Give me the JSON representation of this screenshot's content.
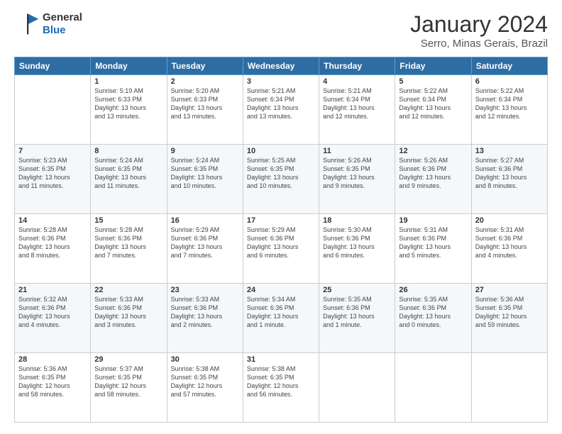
{
  "logo": {
    "line1": "General",
    "line2": "Blue"
  },
  "title": "January 2024",
  "location": "Serro, Minas Gerais, Brazil",
  "days_header": [
    "Sunday",
    "Monday",
    "Tuesday",
    "Wednesday",
    "Thursday",
    "Friday",
    "Saturday"
  ],
  "weeks": [
    [
      {
        "num": "",
        "detail": ""
      },
      {
        "num": "1",
        "detail": "Sunrise: 5:19 AM\nSunset: 6:33 PM\nDaylight: 13 hours\nand 13 minutes."
      },
      {
        "num": "2",
        "detail": "Sunrise: 5:20 AM\nSunset: 6:33 PM\nDaylight: 13 hours\nand 13 minutes."
      },
      {
        "num": "3",
        "detail": "Sunrise: 5:21 AM\nSunset: 6:34 PM\nDaylight: 13 hours\nand 13 minutes."
      },
      {
        "num": "4",
        "detail": "Sunrise: 5:21 AM\nSunset: 6:34 PM\nDaylight: 13 hours\nand 12 minutes."
      },
      {
        "num": "5",
        "detail": "Sunrise: 5:22 AM\nSunset: 6:34 PM\nDaylight: 13 hours\nand 12 minutes."
      },
      {
        "num": "6",
        "detail": "Sunrise: 5:22 AM\nSunset: 6:34 PM\nDaylight: 13 hours\nand 12 minutes."
      }
    ],
    [
      {
        "num": "7",
        "detail": "Sunrise: 5:23 AM\nSunset: 6:35 PM\nDaylight: 13 hours\nand 11 minutes."
      },
      {
        "num": "8",
        "detail": "Sunrise: 5:24 AM\nSunset: 6:35 PM\nDaylight: 13 hours\nand 11 minutes."
      },
      {
        "num": "9",
        "detail": "Sunrise: 5:24 AM\nSunset: 6:35 PM\nDaylight: 13 hours\nand 10 minutes."
      },
      {
        "num": "10",
        "detail": "Sunrise: 5:25 AM\nSunset: 6:35 PM\nDaylight: 13 hours\nand 10 minutes."
      },
      {
        "num": "11",
        "detail": "Sunrise: 5:26 AM\nSunset: 6:35 PM\nDaylight: 13 hours\nand 9 minutes."
      },
      {
        "num": "12",
        "detail": "Sunrise: 5:26 AM\nSunset: 6:36 PM\nDaylight: 13 hours\nand 9 minutes."
      },
      {
        "num": "13",
        "detail": "Sunrise: 5:27 AM\nSunset: 6:36 PM\nDaylight: 13 hours\nand 8 minutes."
      }
    ],
    [
      {
        "num": "14",
        "detail": "Sunrise: 5:28 AM\nSunset: 6:36 PM\nDaylight: 13 hours\nand 8 minutes."
      },
      {
        "num": "15",
        "detail": "Sunrise: 5:28 AM\nSunset: 6:36 PM\nDaylight: 13 hours\nand 7 minutes."
      },
      {
        "num": "16",
        "detail": "Sunrise: 5:29 AM\nSunset: 6:36 PM\nDaylight: 13 hours\nand 7 minutes."
      },
      {
        "num": "17",
        "detail": "Sunrise: 5:29 AM\nSunset: 6:36 PM\nDaylight: 13 hours\nand 6 minutes."
      },
      {
        "num": "18",
        "detail": "Sunrise: 5:30 AM\nSunset: 6:36 PM\nDaylight: 13 hours\nand 6 minutes."
      },
      {
        "num": "19",
        "detail": "Sunrise: 5:31 AM\nSunset: 6:36 PM\nDaylight: 13 hours\nand 5 minutes."
      },
      {
        "num": "20",
        "detail": "Sunrise: 5:31 AM\nSunset: 6:36 PM\nDaylight: 13 hours\nand 4 minutes."
      }
    ],
    [
      {
        "num": "21",
        "detail": "Sunrise: 5:32 AM\nSunset: 6:36 PM\nDaylight: 13 hours\nand 4 minutes."
      },
      {
        "num": "22",
        "detail": "Sunrise: 5:33 AM\nSunset: 6:36 PM\nDaylight: 13 hours\nand 3 minutes."
      },
      {
        "num": "23",
        "detail": "Sunrise: 5:33 AM\nSunset: 6:36 PM\nDaylight: 13 hours\nand 2 minutes."
      },
      {
        "num": "24",
        "detail": "Sunrise: 5:34 AM\nSunset: 6:36 PM\nDaylight: 13 hours\nand 1 minute."
      },
      {
        "num": "25",
        "detail": "Sunrise: 5:35 AM\nSunset: 6:36 PM\nDaylight: 13 hours\nand 1 minute."
      },
      {
        "num": "26",
        "detail": "Sunrise: 5:35 AM\nSunset: 6:36 PM\nDaylight: 13 hours\nand 0 minutes."
      },
      {
        "num": "27",
        "detail": "Sunrise: 5:36 AM\nSunset: 6:35 PM\nDaylight: 12 hours\nand 59 minutes."
      }
    ],
    [
      {
        "num": "28",
        "detail": "Sunrise: 5:36 AM\nSunset: 6:35 PM\nDaylight: 12 hours\nand 58 minutes."
      },
      {
        "num": "29",
        "detail": "Sunrise: 5:37 AM\nSunset: 6:35 PM\nDaylight: 12 hours\nand 58 minutes."
      },
      {
        "num": "30",
        "detail": "Sunrise: 5:38 AM\nSunset: 6:35 PM\nDaylight: 12 hours\nand 57 minutes."
      },
      {
        "num": "31",
        "detail": "Sunrise: 5:38 AM\nSunset: 6:35 PM\nDaylight: 12 hours\nand 56 minutes."
      },
      {
        "num": "",
        "detail": ""
      },
      {
        "num": "",
        "detail": ""
      },
      {
        "num": "",
        "detail": ""
      }
    ]
  ]
}
